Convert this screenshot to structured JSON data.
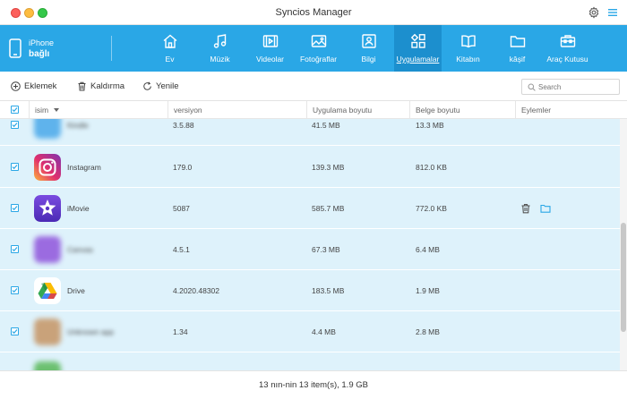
{
  "window": {
    "title": "Syncios Manager"
  },
  "device": {
    "name": "iPhone",
    "status": "bağlı"
  },
  "nav": {
    "items": [
      {
        "label": "Ev",
        "icon": "home-icon"
      },
      {
        "label": "Müzik",
        "icon": "music-icon"
      },
      {
        "label": "Videolar",
        "icon": "video-icon"
      },
      {
        "label": "Fotoğraflar",
        "icon": "photo-icon"
      },
      {
        "label": "Bilgi",
        "icon": "contact-card-icon"
      },
      {
        "label": "Uygulamalar",
        "icon": "apps-icon",
        "active": true
      },
      {
        "label": "Kitabın",
        "icon": "book-icon"
      },
      {
        "label": "kâşif",
        "icon": "folder-icon"
      },
      {
        "label": "Araç Kutusu",
        "icon": "toolbox-icon"
      }
    ]
  },
  "toolbar": {
    "add": "Eklemek",
    "delete": "Kaldırma",
    "refresh": "Yenile"
  },
  "search": {
    "placeholder": "Search"
  },
  "table": {
    "columns": {
      "name": "isim",
      "version": "versiyon",
      "app_size": "Uygulama boyutu",
      "doc_size": "Belge boyutu",
      "actions": "Eylemler"
    },
    "rows": [
      {
        "name": "Kindle",
        "version": "3.5.88",
        "app_size": "41.5 MB",
        "doc_size": "13.3 MB",
        "checked": true,
        "blurred": true
      },
      {
        "name": "Instagram",
        "version": "179.0",
        "app_size": "139.3 MB",
        "doc_size": "812.0 KB",
        "checked": true,
        "blurred": false
      },
      {
        "name": "iMovie",
        "version": "5087",
        "app_size": "585.7 MB",
        "doc_size": "772.0 KB",
        "checked": true,
        "blurred": false,
        "hover": true
      },
      {
        "name": "Canvas",
        "version": "4.5.1",
        "app_size": "67.3 MB",
        "doc_size": "6.4 MB",
        "checked": true,
        "blurred": true
      },
      {
        "name": "Drive",
        "version": "4.2020.48302",
        "app_size": "183.5 MB",
        "doc_size": "1.9 MB",
        "checked": true,
        "blurred": false
      },
      {
        "name": "Unknown app",
        "version": "1.34",
        "app_size": "4.4 MB",
        "doc_size": "2.8 MB",
        "checked": true,
        "blurred": true
      }
    ]
  },
  "status": {
    "text": "13 nın-nin 13 item(s), 1.9 GB"
  },
  "colors": {
    "accent": "#2aa7e6",
    "nav_active": "#1c8fce",
    "row_selected": "#def2fb"
  }
}
